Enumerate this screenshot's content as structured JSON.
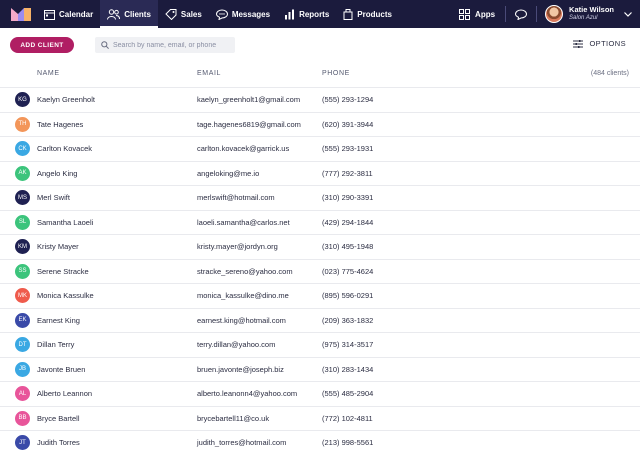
{
  "nav": {
    "items": [
      {
        "label": "Calendar",
        "icon": "calendar-icon"
      },
      {
        "label": "Clients",
        "icon": "clients-icon",
        "active": true
      },
      {
        "label": "Sales",
        "icon": "tag-icon"
      },
      {
        "label": "Messages",
        "icon": "messages-icon"
      },
      {
        "label": "Reports",
        "icon": "reports-icon"
      },
      {
        "label": "Products",
        "icon": "products-icon"
      }
    ],
    "apps_label": "Apps",
    "user": {
      "name": "Katie Wilson",
      "salon": "Salon Azul"
    },
    "bg_color": "#1b1b3d"
  },
  "toolbar": {
    "add_client_label": "ADD CLIENT",
    "search_placeholder": "Search by name, email, or phone",
    "options_label": "OPTIONS",
    "accent_color": "#b01e63"
  },
  "table": {
    "columns": {
      "name": "NAME",
      "email": "EMAIL",
      "phone": "PHONE"
    },
    "count": "(484 clients)",
    "rows": [
      {
        "initials": "KG",
        "name": "Kaelyn Greenholt",
        "email": "kaelyn_greenholt1@gmail.com",
        "phone": "(555) 293-1294",
        "color": "#1f2152"
      },
      {
        "initials": "TH",
        "name": "Tate Hagenes",
        "email": "tage.hagenes6819@gmail.com",
        "phone": "(620) 391-3944",
        "color": "#f3965a"
      },
      {
        "initials": "CK",
        "name": "Carlton Kovacek",
        "email": "carlton.kovacek@garrick.us",
        "phone": "(555) 293-1931",
        "color": "#3aa8e3"
      },
      {
        "initials": "AK",
        "name": "Angelo King",
        "email": "angeloking@me.io",
        "phone": "(777) 292-3811",
        "color": "#3cc47c"
      },
      {
        "initials": "MS",
        "name": "Merl Swift",
        "email": "merlswift@hotmail.com",
        "phone": "(310) 290-3391",
        "color": "#1f2152"
      },
      {
        "initials": "SL",
        "name": "Samantha Laoeli",
        "email": "laoeli.samantha@carlos.net",
        "phone": "(429) 294-1844",
        "color": "#3cc47c"
      },
      {
        "initials": "KM",
        "name": "Kristy Mayer",
        "email": "kristy.mayer@jordyn.org",
        "phone": "(310) 495-1948",
        "color": "#1f2152"
      },
      {
        "initials": "SS",
        "name": "Serene Stracke",
        "email": "stracke_sereno@yahoo.com",
        "phone": "(023) 775-4624",
        "color": "#3cc47c"
      },
      {
        "initials": "MK",
        "name": "Monica Kassulke",
        "email": "monica_kassulke@dino.me",
        "phone": "(895) 596-0291",
        "color": "#ef5b4c"
      },
      {
        "initials": "EK",
        "name": "Earnest King",
        "email": "earnest.king@hotmail.com",
        "phone": "(209) 363-1832",
        "color": "#3a4aa8"
      },
      {
        "initials": "DT",
        "name": "Dillan Terry",
        "email": "terry.dillan@yahoo.com",
        "phone": "(975) 314-3517",
        "color": "#3aa8e3"
      },
      {
        "initials": "JB",
        "name": "Javonte Bruen",
        "email": "bruen.javonte@joseph.biz",
        "phone": "(310) 283-1434",
        "color": "#3aa8e3"
      },
      {
        "initials": "AL",
        "name": "Alberto Leannon",
        "email": "alberto.leanonn4@yahoo.com",
        "phone": "(555) 485-2904",
        "color": "#e8559a"
      },
      {
        "initials": "BB",
        "name": "Bryce Bartell",
        "email": "brycebartell11@co.uk",
        "phone": "(772) 102-4811",
        "color": "#e8559a"
      },
      {
        "initials": "JT",
        "name": "Judith Torres",
        "email": "judith_torres@hotmail.com",
        "phone": "(213) 998-5561",
        "color": "#3a4aa8"
      }
    ]
  }
}
